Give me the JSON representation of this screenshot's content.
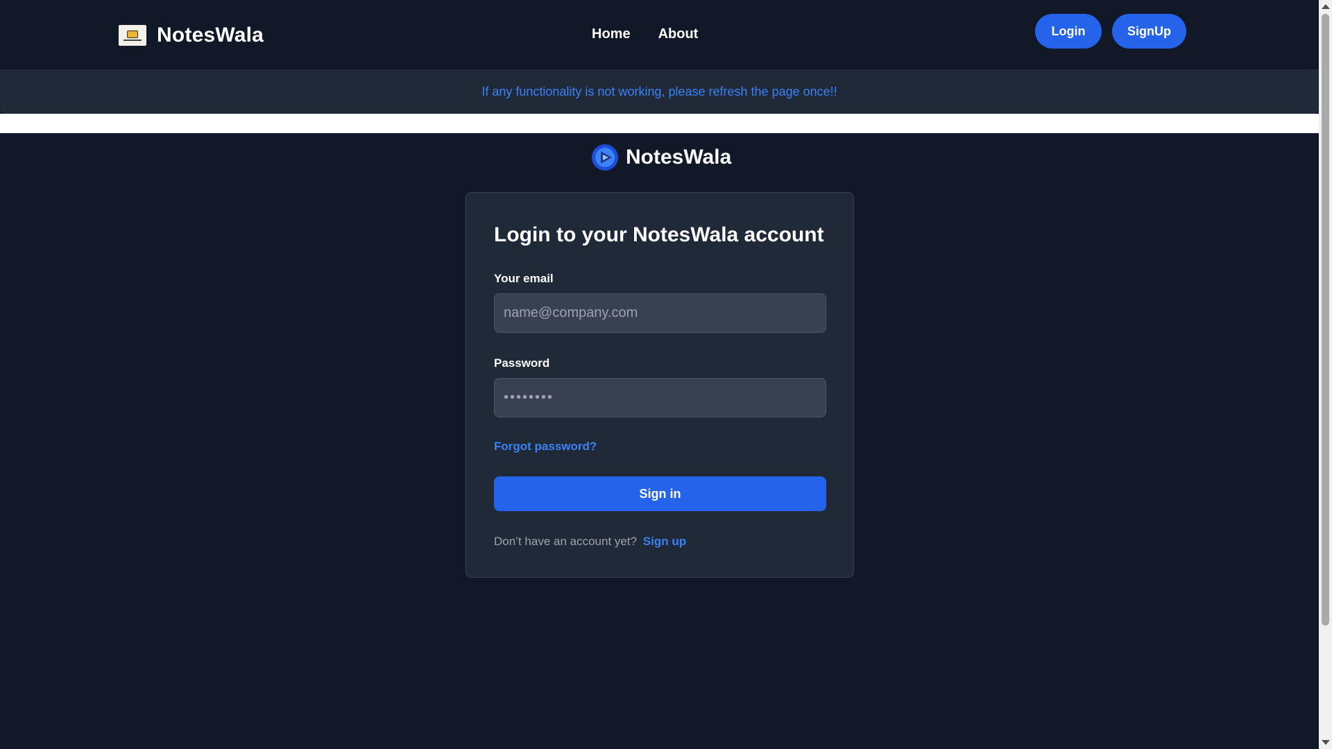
{
  "navbar": {
    "brand": "NotesWala",
    "links": [
      {
        "label": "Home"
      },
      {
        "label": "About"
      }
    ],
    "login_label": "Login",
    "signup_label": "SignUp"
  },
  "banner": {
    "text": "If any functionality is not working, please refresh the page once!!"
  },
  "center_brand": {
    "name": "NotesWala"
  },
  "login_form": {
    "title": "Login to your NotesWala account",
    "email_label": "Your email",
    "email_placeholder": "name@company.com",
    "email_value": "",
    "password_label": "Password",
    "password_placeholder": "••••••••",
    "password_value": "",
    "forgot_label": "Forgot password?",
    "submit_label": "Sign in",
    "no_account_text": "Don’t have an account yet?",
    "signup_link_label": "Sign up"
  },
  "colors": {
    "background": "#111827",
    "card": "#1f2937",
    "accent": "#2563eb",
    "link": "#3b82f6"
  }
}
